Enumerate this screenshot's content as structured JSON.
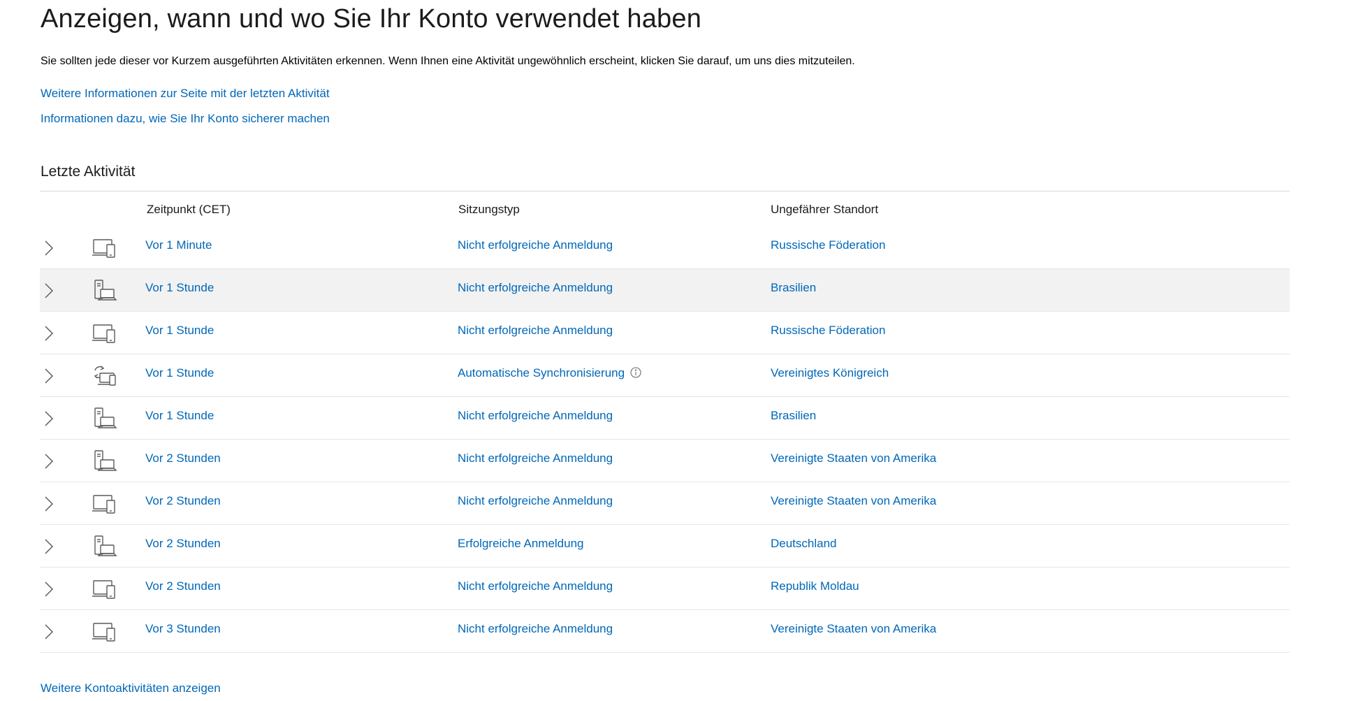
{
  "page": {
    "title": "Anzeigen, wann und wo Sie Ihr Konto verwendet haben",
    "description": "Sie sollten jede dieser vor Kurzem ausgeführten Aktivitäten erkennen. Wenn Ihnen eine Aktivität ungewöhnlich erscheint, klicken Sie darauf, um uns dies mitzuteilen.",
    "link_more_info": "Weitere Informationen zur Seite mit der letzten Aktivität",
    "link_secure_account": "Informationen dazu, wie Sie Ihr Konto sicherer machen"
  },
  "activity": {
    "section_title": "Letzte Aktivität",
    "headers": {
      "time": "Zeitpunkt (CET)",
      "session_type": "Sitzungstyp",
      "location": "Ungefährer Standort"
    },
    "rows": [
      {
        "device_icon": "multi-device-icon",
        "time": "Vor 1 Minute",
        "session_type": "Nicht erfolgreiche Anmeldung",
        "location": "Russische Föderation",
        "highlighted": false
      },
      {
        "device_icon": "desktop-laptop-icon",
        "time": "Vor 1 Stunde",
        "session_type": "Nicht erfolgreiche Anmeldung",
        "location": "Brasilien",
        "highlighted": true
      },
      {
        "device_icon": "multi-device-icon",
        "time": "Vor 1 Stunde",
        "session_type": "Nicht erfolgreiche Anmeldung",
        "location": "Russische Föderation",
        "highlighted": false
      },
      {
        "device_icon": "sync-device-icon",
        "time": "Vor 1 Stunde",
        "session_type": "Automatische Synchronisierung",
        "location": "Vereinigtes Königreich",
        "highlighted": false,
        "has_info": true
      },
      {
        "device_icon": "desktop-laptop-icon",
        "time": "Vor 1 Stunde",
        "session_type": "Nicht erfolgreiche Anmeldung",
        "location": "Brasilien",
        "highlighted": false
      },
      {
        "device_icon": "desktop-laptop-icon",
        "time": "Vor 2 Stunden",
        "session_type": "Nicht erfolgreiche Anmeldung",
        "location": "Vereinigte Staaten von Amerika",
        "highlighted": false
      },
      {
        "device_icon": "multi-device-icon",
        "time": "Vor 2 Stunden",
        "session_type": "Nicht erfolgreiche Anmeldung",
        "location": "Vereinigte Staaten von Amerika",
        "highlighted": false
      },
      {
        "device_icon": "desktop-laptop-icon",
        "time": "Vor 2 Stunden",
        "session_type": "Erfolgreiche Anmeldung",
        "location": "Deutschland",
        "highlighted": false
      },
      {
        "device_icon": "multi-device-icon",
        "time": "Vor 2 Stunden",
        "session_type": "Nicht erfolgreiche Anmeldung",
        "location": "Republik Moldau",
        "highlighted": false
      },
      {
        "device_icon": "multi-device-icon",
        "time": "Vor 3 Stunden",
        "session_type": "Nicht erfolgreiche Anmeldung",
        "location": "Vereinigte Staaten von Amerika",
        "highlighted": false
      }
    ],
    "more_link": "Weitere Kontoaktivitäten anzeigen"
  },
  "colors": {
    "link": "#0067b8",
    "row_highlight": "#f2f2f2",
    "divider": "#e6e6e6"
  }
}
